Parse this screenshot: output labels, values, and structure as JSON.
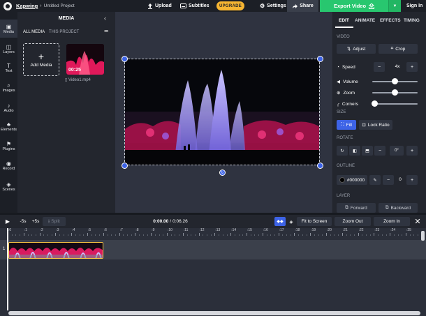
{
  "topbar": {
    "brand": "Kapwing",
    "separator": "›",
    "project": "Untitled Project",
    "upload": "Upload",
    "subtitles": "Subtitles",
    "upgrade": "UPGRADE",
    "settings": "Settings",
    "share": "Share",
    "export": "Export Video",
    "signin": "Sign In"
  },
  "rail": [
    {
      "label": "Media",
      "icon": "media-icon"
    },
    {
      "label": "Layers",
      "icon": "layers-icon"
    },
    {
      "label": "Text",
      "icon": "text-icon"
    },
    {
      "label": "Images",
      "icon": "images-icon"
    },
    {
      "label": "Audio",
      "icon": "audio-icon"
    },
    {
      "label": "Elements",
      "icon": "elements-icon"
    },
    {
      "label": "Plugins",
      "icon": "plugins-icon"
    },
    {
      "label": "Record",
      "icon": "record-icon"
    },
    {
      "label": "Scenes",
      "icon": "scenes-icon"
    }
  ],
  "media": {
    "title": "MEDIA",
    "tab_all": "ALL MEDIA",
    "tab_project": "THIS PROJECT",
    "add_media": "Add Media",
    "thumb_duration": "00:25",
    "thumb_name": "Video1.mp4"
  },
  "props": {
    "tabs": [
      "EDIT",
      "ANIMATE",
      "EFFECTS",
      "TIMING"
    ],
    "video_label": "VIDEO",
    "adjust": "Adjust",
    "crop": "Crop",
    "speed_label": "Speed",
    "speed_value": "4x",
    "volume_label": "Volume",
    "volume_level": 0.5,
    "zoom_label": "Zoom",
    "zoom_level": 0.5,
    "corners_label": "Corners",
    "corners_level": 0,
    "size_label": "SIZE",
    "fill": "Fill",
    "lock_ratio": "Lock Ratio",
    "rotate_label": "ROTATE",
    "outline_label": "OUTLINE",
    "outline_color": "#000000",
    "outline_value": "0",
    "layer_label": "LAYER",
    "forward": "Forward",
    "backward": "Backward"
  },
  "timeline": {
    "back5": "-5s",
    "fwd5": "+5s",
    "split": "Split",
    "time_current": "0:00.00",
    "time_sep": "/",
    "time_total": "0:06.26",
    "fit": "Fit to Screen",
    "zoom_out": "Zoom Out",
    "zoom_in": "Zoom In",
    "ticks": [
      ":0",
      ":1",
      ":2",
      ":3",
      ":4",
      ":5",
      ":6",
      ":7",
      ":8",
      ":9",
      ":10",
      ":11",
      ":12",
      ":13",
      ":14",
      ":15",
      ":16",
      ":17",
      ":18",
      ":19",
      ":20",
      ":21",
      ":22",
      ":23",
      ":24",
      ":25"
    ],
    "track_number": "1"
  },
  "colors": {
    "accent": "#3d63e6",
    "export": "#28c76f",
    "upgrade": "#f6b532",
    "clip_border": "#f6c343"
  }
}
